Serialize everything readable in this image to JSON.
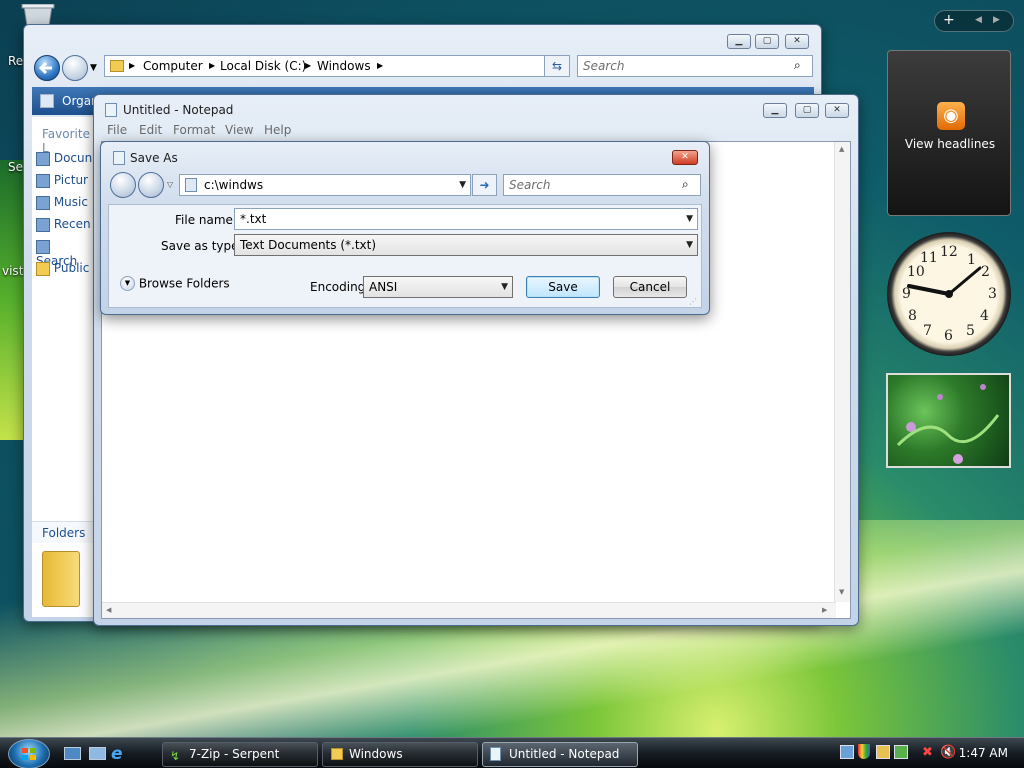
{
  "desktop": {
    "icon_labels": [
      "Re",
      "Se",
      "vista"
    ]
  },
  "explorer": {
    "breadcrumb": [
      "Computer",
      "Local Disk (C:)",
      "Windows"
    ],
    "search_placeholder": "Search",
    "organize_label": "Organ",
    "favorite_links_label": "Favorite L",
    "links": [
      "Docun",
      "Pictur",
      "Music",
      "Recen",
      "Search",
      "Public"
    ],
    "folders_label": "Folders"
  },
  "notepad": {
    "title": "Untitled - Notepad",
    "menu": [
      "File",
      "Edit",
      "Format",
      "View",
      "Help"
    ]
  },
  "save_as": {
    "title": "Save As",
    "address_value": "c:\\windws",
    "search_placeholder": "Search",
    "file_name_label": "File name:",
    "file_name_value": "*.txt",
    "save_as_type_label": "Save as type:",
    "save_as_type_value": "Text Documents (*.txt)",
    "browse_folders_label": "Browse Folders",
    "encoding_label": "Encoding:",
    "encoding_value": "ANSI",
    "save_label": "Save",
    "cancel_label": "Cancel"
  },
  "sidebar": {
    "headlines_label": "View headlines",
    "clock_numbers": [
      "12",
      "1",
      "2",
      "3",
      "4",
      "5",
      "6",
      "7",
      "8",
      "9",
      "10",
      "11"
    ]
  },
  "taskbar": {
    "buttons": [
      "7-Zip - Serpent",
      "Windows",
      "Untitled - Notepad"
    ],
    "time": "1:47 AM"
  },
  "colors": {
    "accent": "#2f78c5",
    "taskbar": "#161c22"
  }
}
